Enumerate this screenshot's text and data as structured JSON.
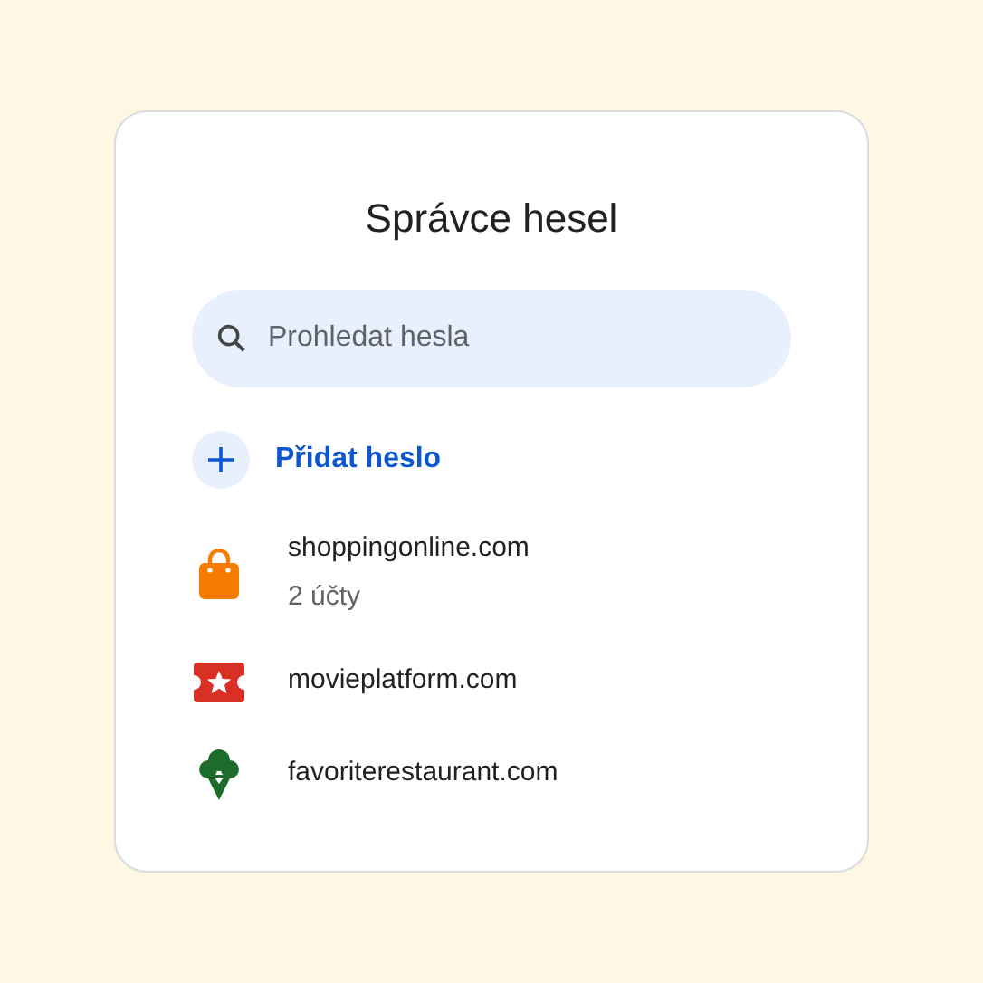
{
  "title": "Správce hesel",
  "search": {
    "placeholder": "Prohledat hesla"
  },
  "add_button": {
    "label": "Přidat heslo"
  },
  "sites": [
    {
      "kind": "bag",
      "name": "shoppingonline.com",
      "detail": "2 účty"
    },
    {
      "kind": "ticket",
      "name": "movieplatform.com"
    },
    {
      "kind": "tree",
      "name": "favoriterestaurant.com"
    }
  ]
}
